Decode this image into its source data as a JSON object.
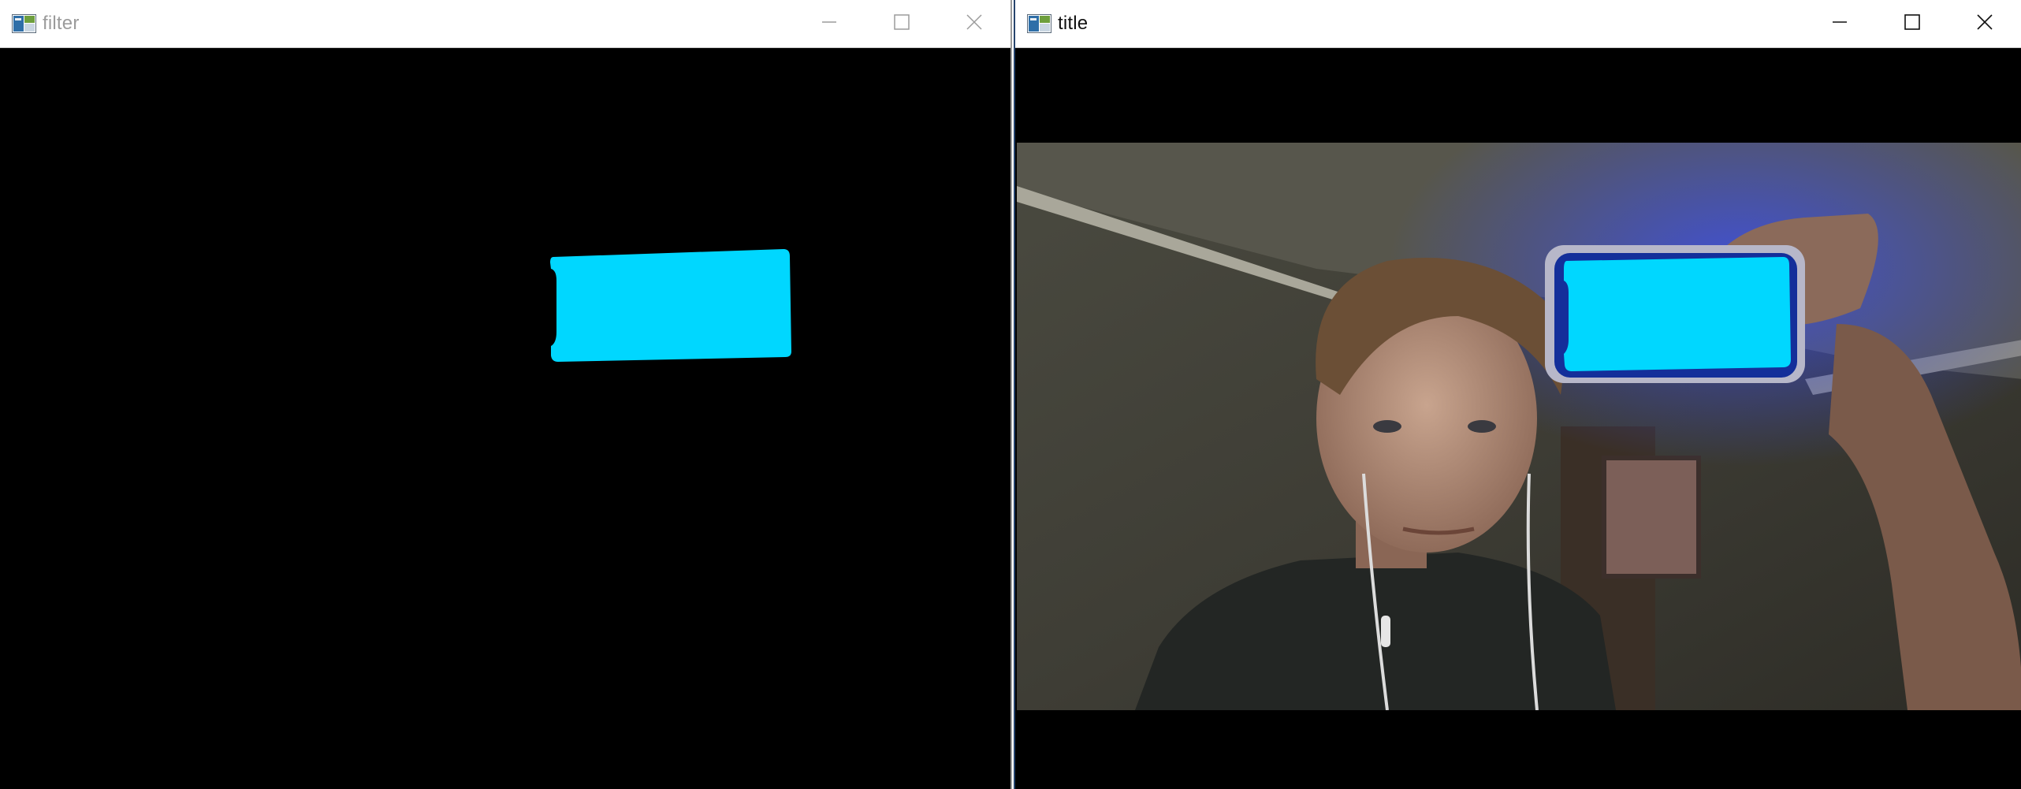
{
  "windows": [
    {
      "title": "filter",
      "focused": false,
      "controls": {
        "minimize": "minimize-icon",
        "maximize": "maximize-icon",
        "close": "close-icon"
      }
    },
    {
      "title": "title",
      "focused": true,
      "controls": {
        "minimize": "minimize-icon",
        "maximize": "maximize-icon",
        "close": "close-icon"
      }
    }
  ],
  "colors": {
    "detected_cyan": "#00d7ff",
    "canvas_black": "#000000",
    "inactive_title": "#9b9b9b",
    "active_title": "#111111"
  }
}
